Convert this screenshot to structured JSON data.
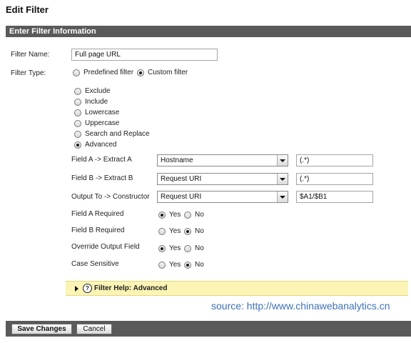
{
  "page": {
    "title": "Edit Filter"
  },
  "section": {
    "title": "Enter Filter Information"
  },
  "filter_name": {
    "label": "Filter Name:",
    "value": "Full page URL"
  },
  "filter_type": {
    "label": "Filter Type:",
    "predefined_label": "Predefined filter",
    "custom_label": "Custom filter",
    "selected": "custom"
  },
  "custom_options": {
    "selected": "Advanced",
    "items": [
      "Exclude",
      "Include",
      "Lowercase",
      "Uppercase",
      "Search and Replace",
      "Advanced"
    ]
  },
  "advanced": {
    "field_a": {
      "label": "Field A -> Extract A",
      "select": "Hostname",
      "pattern": "(.*)"
    },
    "field_b": {
      "label": "Field B -> Extract B",
      "select": "Request URI",
      "pattern": "(.*)"
    },
    "output": {
      "label": "Output To -> Constructor",
      "select": "Request URI",
      "pattern": "$A1/$B1"
    }
  },
  "yes_no": {
    "yes": "Yes",
    "no": "No",
    "rows": [
      {
        "label": "Field A Required",
        "value": "Yes"
      },
      {
        "label": "Field B Required",
        "value": "No"
      },
      {
        "label": "Override Output Field",
        "value": "Yes"
      },
      {
        "label": "Case Sensitive",
        "value": "No"
      }
    ]
  },
  "help": {
    "icon": "?",
    "text": "Filter Help: Advanced"
  },
  "source": "source: http://www.chinawebanalytics.cn",
  "footer": {
    "save": "Save Changes",
    "cancel": "Cancel"
  }
}
